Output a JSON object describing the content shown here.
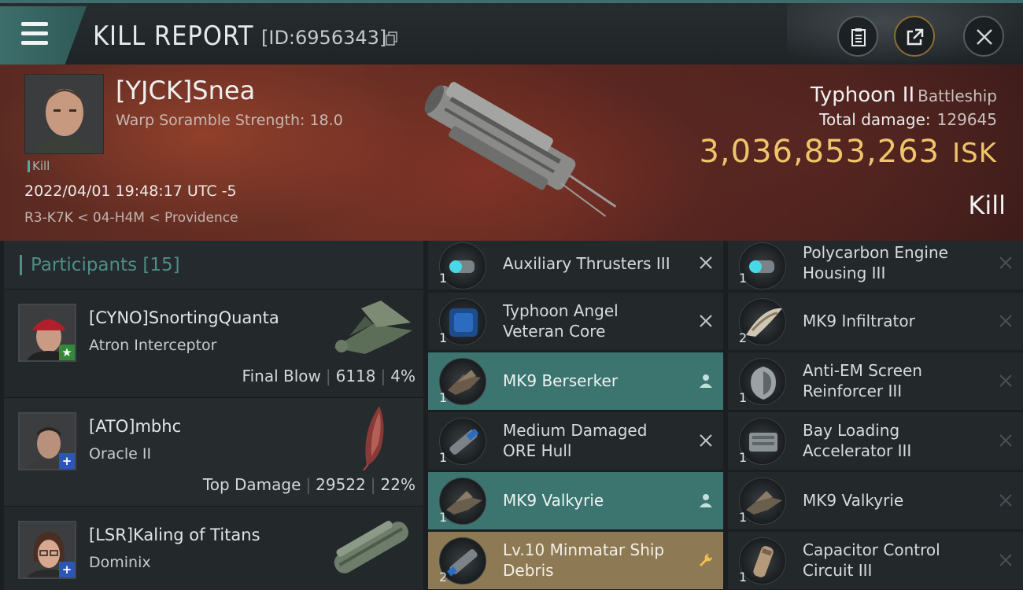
{
  "header": {
    "title": "KILL REPORT",
    "id_text": "[ID:6956343]",
    "icons": [
      "menu-icon",
      "copy-icon",
      "clipboard-icon",
      "share-icon",
      "close-icon"
    ]
  },
  "victim": {
    "name": "[YJCK]Snea",
    "warp_scramble": "Warp Soramble Strength: 18.0",
    "tag": "Kill",
    "datetime": "2022/04/01 19:48:17 UTC -5",
    "location": "R3-K7K < 04-H4M < Providence",
    "ship_name": "Typhoon II",
    "ship_class": "Battleship",
    "total_damage_label": "Total damage:",
    "total_damage": "129645",
    "isk_value": "3,036,853,263",
    "isk_unit": "ISK",
    "result": "Kill"
  },
  "participants": {
    "title": "Participants",
    "count": "[15]",
    "list": [
      {
        "name": "[CYNO]SnortingQuanta",
        "ship": "Atron Interceptor",
        "role": "Final Blow",
        "damage": "6118",
        "percent": "4%",
        "badge": "★"
      },
      {
        "name": "[ATO]mbhc",
        "ship": "Oracle II",
        "role": "Top Damage",
        "damage": "29522",
        "percent": "22%",
        "badge": "+"
      },
      {
        "name": "[LSR]Kaling of Titans",
        "ship": "Dominix",
        "badge": "+"
      }
    ]
  },
  "items": {
    "left": [
      {
        "qty": "1",
        "line1": "Auxiliary Thrusters III",
        "line2": "",
        "action": "close-icon",
        "style": "plain"
      },
      {
        "qty": "1",
        "line1": "Typhoon Angel",
        "line2": "Veteran Core",
        "action": "close-icon",
        "style": "plain"
      },
      {
        "qty": "1",
        "line1": "MK9  Berserker",
        "line2": "",
        "action": "person-icon",
        "style": "teal"
      },
      {
        "qty": "1",
        "line1": "Medium Damaged",
        "line2": "ORE Hull",
        "action": "close-icon",
        "style": "plain"
      },
      {
        "qty": "1",
        "line1": "MK9  Valkyrie",
        "line2": "",
        "action": "person-icon",
        "style": "teal"
      },
      {
        "qty": "2",
        "line1": "Lv.10 Minmatar Ship",
        "line2": "Debris",
        "action": "wrench-icon",
        "style": "gold"
      }
    ],
    "right": [
      {
        "qty": "1",
        "line1": "Polycarbon Engine",
        "line2": "Housing III",
        "action": "close-icon",
        "style": "plain"
      },
      {
        "qty": "2",
        "line1": "MK9  Infiltrator",
        "line2": "",
        "action": "close-icon",
        "style": "plain"
      },
      {
        "qty": "1",
        "line1": "Anti-EM Screen",
        "line2": "Reinforcer III",
        "action": "close-icon",
        "style": "plain"
      },
      {
        "qty": "1",
        "line1": "Bay Loading",
        "line2": "Accelerator III",
        "action": "close-icon",
        "style": "plain"
      },
      {
        "qty": "1",
        "line1": "MK9  Valkyrie",
        "line2": "",
        "action": "close-icon",
        "style": "plain"
      },
      {
        "qty": "1",
        "line1": "Capacitor Control",
        "line2": "Circuit III",
        "action": "close-icon",
        "style": "plain"
      }
    ]
  },
  "colors": {
    "accent": "#4f8d86",
    "isk": "#efc46a",
    "teal_row": "#3c7470",
    "gold_row": "#8d7a55"
  }
}
